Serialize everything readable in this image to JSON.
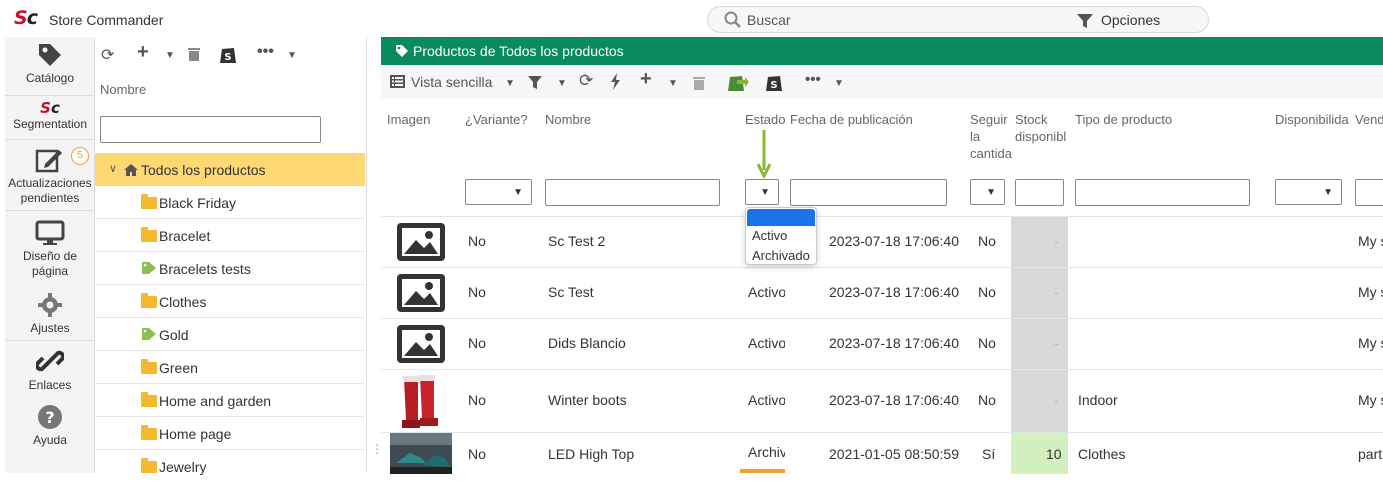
{
  "app": {
    "title_a": "S",
    "title_b": "c",
    "name": "Store Commander"
  },
  "search": {
    "placeholder": "Buscar",
    "options_label": "Opciones"
  },
  "leftnav": [
    {
      "icon": "tag-icon",
      "label": "Catálogo"
    },
    {
      "icon": "segmentation-icon",
      "label": "Segmentation"
    },
    {
      "icon": "edit-icon",
      "label_line1": "Actualizaciones",
      "label_line2": "pendientes",
      "badge": "5"
    },
    {
      "icon": "monitor-icon",
      "label_line1": "Diseño de",
      "label_line2": "página"
    },
    {
      "icon": "gear-icon",
      "label": "Ajustes"
    },
    {
      "icon": "link-icon",
      "label": "Enlaces"
    },
    {
      "icon": "help-icon",
      "label": "Ayuda"
    }
  ],
  "tree": {
    "column_header": "Nombre",
    "root": "Todos los productos",
    "items": [
      {
        "label": "Black Friday",
        "type": "folder"
      },
      {
        "label": "Bracelet",
        "type": "folder"
      },
      {
        "label": "Bracelets tests",
        "type": "tag"
      },
      {
        "label": "Clothes",
        "type": "folder"
      },
      {
        "label": "Gold",
        "type": "tag"
      },
      {
        "label": "Green",
        "type": "folder"
      },
      {
        "label": "Home and garden",
        "type": "folder"
      },
      {
        "label": "Home page",
        "type": "folder"
      },
      {
        "label": "Jewelry",
        "type": "folder"
      }
    ]
  },
  "main": {
    "header": "Productos de Todos los productos",
    "view_label": "Vista sencilla",
    "columns": {
      "imagen": "Imagen",
      "variante": "¿Variante?",
      "nombre": "Nombre",
      "estado": "Estado",
      "fecha": "Fecha de publicación",
      "seguir_1": "Seguir",
      "seguir_2": "la",
      "seguir_3": "cantida",
      "stock_1": "Stock",
      "stock_2": "disponibl",
      "tipo": "Tipo de producto",
      "disp": "Disponibilida",
      "vend": "Vend"
    },
    "estado_dropdown": {
      "options": [
        "Activo",
        "Archivado"
      ]
    },
    "rows": [
      {
        "variante": "No",
        "nombre": "Sc Test 2",
        "estado": "",
        "fecha": "2023-07-18 17:06:40",
        "seguir": "No",
        "stock": "-",
        "tipo": "",
        "vend": "My s"
      },
      {
        "variante": "No",
        "nombre": "Sc Test",
        "estado": "Activo",
        "fecha": "2023-07-18 17:06:40",
        "seguir": "No",
        "stock": "-",
        "tipo": "",
        "vend": "My s"
      },
      {
        "variante": "No",
        "nombre": "Dids Blancio",
        "estado": "Activo",
        "fecha": "2023-07-18 17:06:40",
        "seguir": "No",
        "stock": "-",
        "tipo": "",
        "vend": "My s"
      },
      {
        "variante": "No",
        "nombre": "Winter boots",
        "estado": "Activo",
        "fecha": "2023-07-18 17:06:40",
        "seguir": "No",
        "stock": "-",
        "tipo": "Indoor",
        "vend": "My s"
      },
      {
        "variante": "No",
        "nombre": "LED High Top",
        "estado": "Archivado",
        "fecha": "2021-01-05 08:50:59",
        "seguir": "Sí",
        "stock": "10",
        "tipo": "Clothes",
        "vend": "part"
      }
    ]
  },
  "colors": {
    "brand_red": "#c8102e",
    "header_green": "#0a8a5f",
    "selected_row": "#fdd873",
    "folder": "#f5b82e",
    "tag_green": "#8cc152",
    "arrow_green": "#8ab833"
  }
}
